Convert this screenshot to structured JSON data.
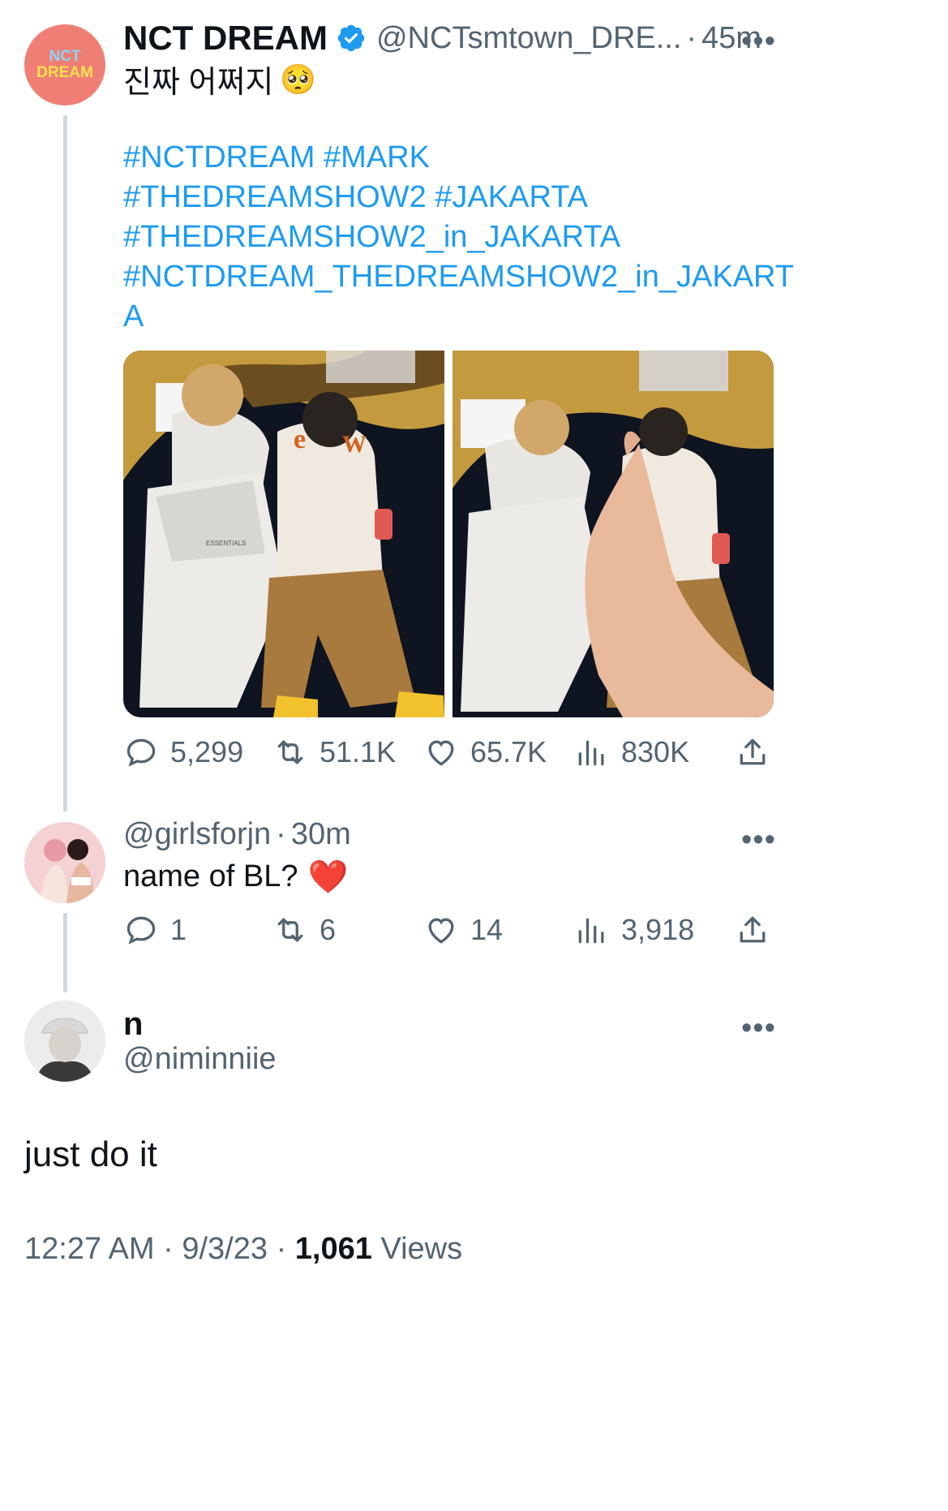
{
  "tweet": {
    "author_name": "NCT DREAM",
    "handle": "@NCTsmtown_DRE...",
    "separator": "·",
    "time": "45m",
    "text": "진짜 어쩌지",
    "emoji": "🥺",
    "hashtags": [
      "#NCTDREAM #MARK",
      "#THEDREAMSHOW2 #JAKARTA",
      "#THEDREAMSHOW2_in_JAKARTA",
      "#NCTDREAM_THEDREAMSHOW2_in_JAKART",
      "A"
    ],
    "avatar_logo": {
      "line1": "NCT",
      "line2": "DREAM"
    },
    "metrics": {
      "replies": "5,299",
      "retweets": "51.1K",
      "likes": "65.7K",
      "views": "830K"
    },
    "photo_texts": {
      "jacket_letter": "W",
      "jacket_letter2": "e",
      "pants_text": "ESSENTIALS"
    }
  },
  "reply1": {
    "handle": "@girlsforjn",
    "separator": "·",
    "time": "30m",
    "text": "name of BL?",
    "emoji": "❤️",
    "metrics": {
      "replies": "1",
      "retweets": "6",
      "likes": "14",
      "views": "3,918"
    }
  },
  "reply2": {
    "name": "n",
    "handle": "@niminniie",
    "text": "just do it",
    "footer": {
      "time": "12:27 AM",
      "sep1": "·",
      "date": "9/3/23",
      "sep2": "·",
      "views_count": "1,061",
      "views_label": "Views"
    }
  },
  "colors": {
    "accent": "#1d9bf0",
    "muted": "#536471",
    "heart": "#e0245e"
  }
}
